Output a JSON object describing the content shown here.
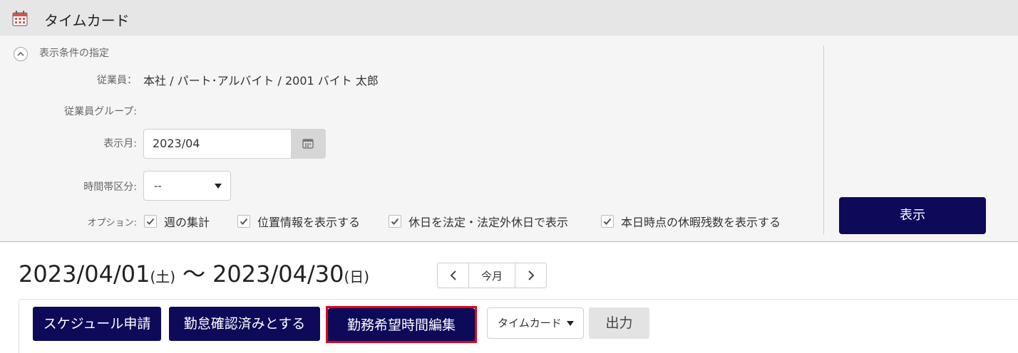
{
  "header": {
    "title": "タイムカード",
    "icon": "calendar-icon",
    "icon_color": "#d9534f"
  },
  "conditions": {
    "heading": "表示条件の指定",
    "employee_label": "従業員：",
    "employee_value": "本社 / パート･アルバイト / 2001 バイト 太郎",
    "group_label": "従業員グループ:",
    "month_label": "表示月:",
    "month_value": "2023/04",
    "timeslot_label": "時間帯区分:",
    "timeslot_value": "--",
    "options_label": "オプション:",
    "options": [
      {
        "label": "週の集計",
        "checked": true
      },
      {
        "label": "位置情報を表示する",
        "checked": true
      },
      {
        "label": "休日を法定・法定外休日で表示",
        "checked": true
      },
      {
        "label": "本日時点の休暇残数を表示する",
        "checked": true
      }
    ],
    "show_button": "表示"
  },
  "period": {
    "start": "2023/04/01",
    "start_dow": "(土)",
    "separator": "〜",
    "end": "2023/04/30",
    "end_dow": "(日)"
  },
  "pager": {
    "prev": "<",
    "today": "今月",
    "next": ">"
  },
  "actions": {
    "schedule_request": "スケジュール申請",
    "mark_confirmed": "勤怠確認済みとする",
    "edit_preferred_hours": "勤務希望時間編集",
    "format_select": "タイムカード",
    "output": "出力"
  },
  "colors": {
    "primary": "#0d0a5a",
    "highlight": "#e0001a",
    "header_bg": "#e6e6e6",
    "panel_bg": "#f5f5f5"
  }
}
